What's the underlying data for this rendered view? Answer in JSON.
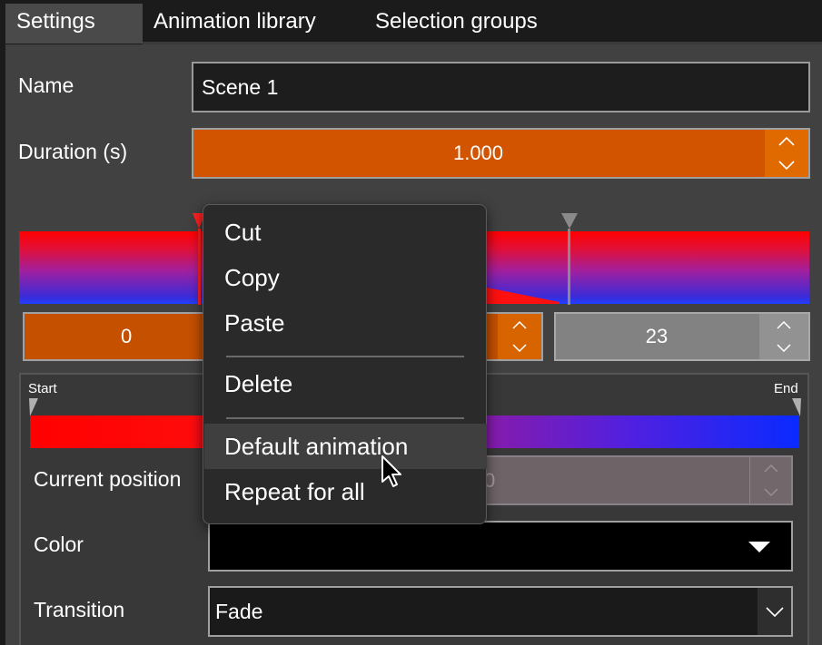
{
  "tabs": [
    {
      "label": "Settings",
      "active": true
    },
    {
      "label": "Animation library",
      "active": false
    },
    {
      "label": "Selection groups",
      "active": false
    }
  ],
  "name_label": "Name",
  "name_value": "Scene 1",
  "duration_label": "Duration (s)",
  "duration_value": "1.000",
  "keyframe_left_value": "0",
  "keyframe_right_value": "23",
  "gradient_start_label": "Start",
  "gradient_end_label": "End",
  "current_position_label": "Current position",
  "current_position_value": "0",
  "color_label": "Color",
  "transition_label": "Transition",
  "transition_value": "Fade",
  "context_menu": {
    "items": [
      {
        "label": "Cut"
      },
      {
        "label": "Copy"
      },
      {
        "label": "Paste"
      },
      {
        "label": "Delete"
      },
      {
        "label": "Default animation"
      },
      {
        "label": "Repeat for all"
      }
    ],
    "hovered": "Default animation"
  },
  "colors": {
    "accent_orange": "#d35400",
    "panel_bg": "#414141",
    "menu_bg": "#2a2a2a"
  }
}
